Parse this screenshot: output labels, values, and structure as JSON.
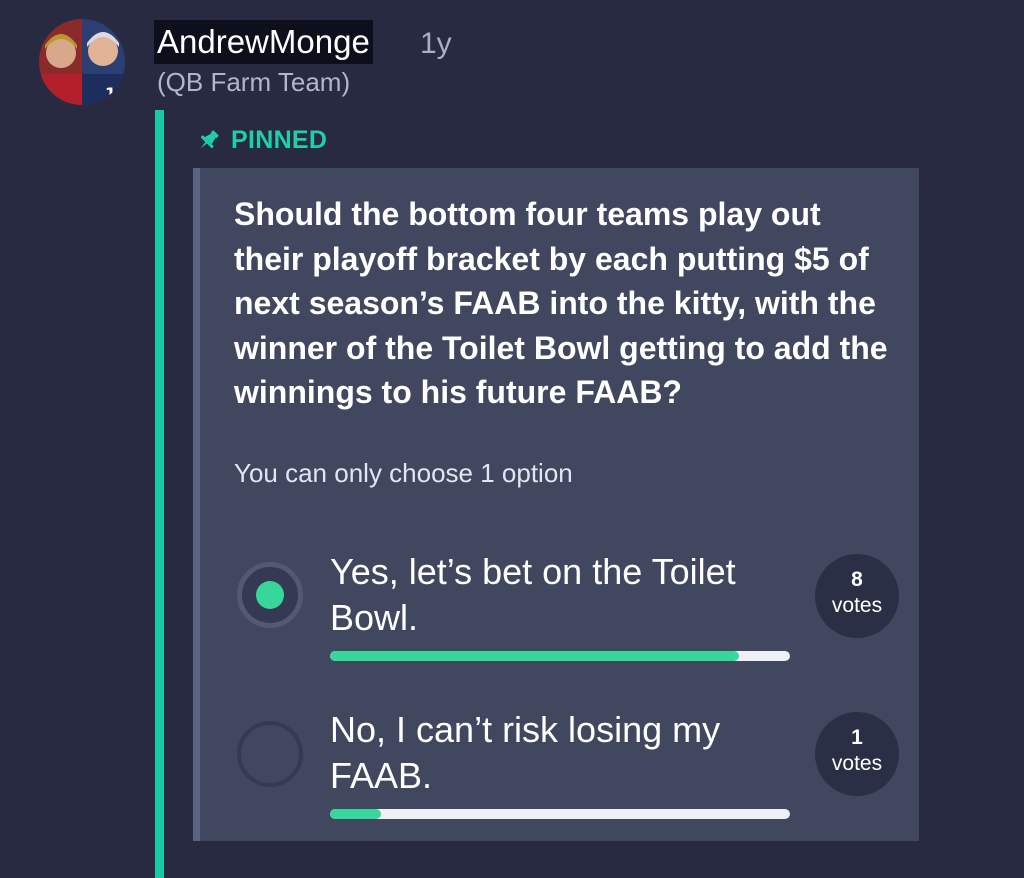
{
  "post": {
    "author": "AndrewMonge",
    "time": "1y",
    "team": "(QB Farm Team)",
    "pinned_label": "PINNED"
  },
  "poll": {
    "question": "Should the bottom four teams play out their playoff bracket by each putting $5 of next season’s FAAB into the kitty, with the winner of the Toilet Bowl getting to add the winnings to his future FAAB?",
    "instructions": "You can only choose 1 option",
    "options": [
      {
        "label": "Yes, let’s bet on the Toilet Bowl.",
        "votes": "8",
        "votes_unit": "votes",
        "selected": true,
        "share": 0.89
      },
      {
        "label": "No, I can’t risk losing my FAAB.",
        "votes": "1",
        "votes_unit": "votes",
        "selected": false,
        "share": 0.11
      }
    ]
  },
  "colors": {
    "background": "#272a40",
    "accent": "#19c9a6",
    "pinned": "#1fcfa8",
    "card": "#41475f",
    "progress": "#37d79c"
  },
  "icons": {
    "pin": "pushpin-icon",
    "avatar": "user-avatar"
  }
}
